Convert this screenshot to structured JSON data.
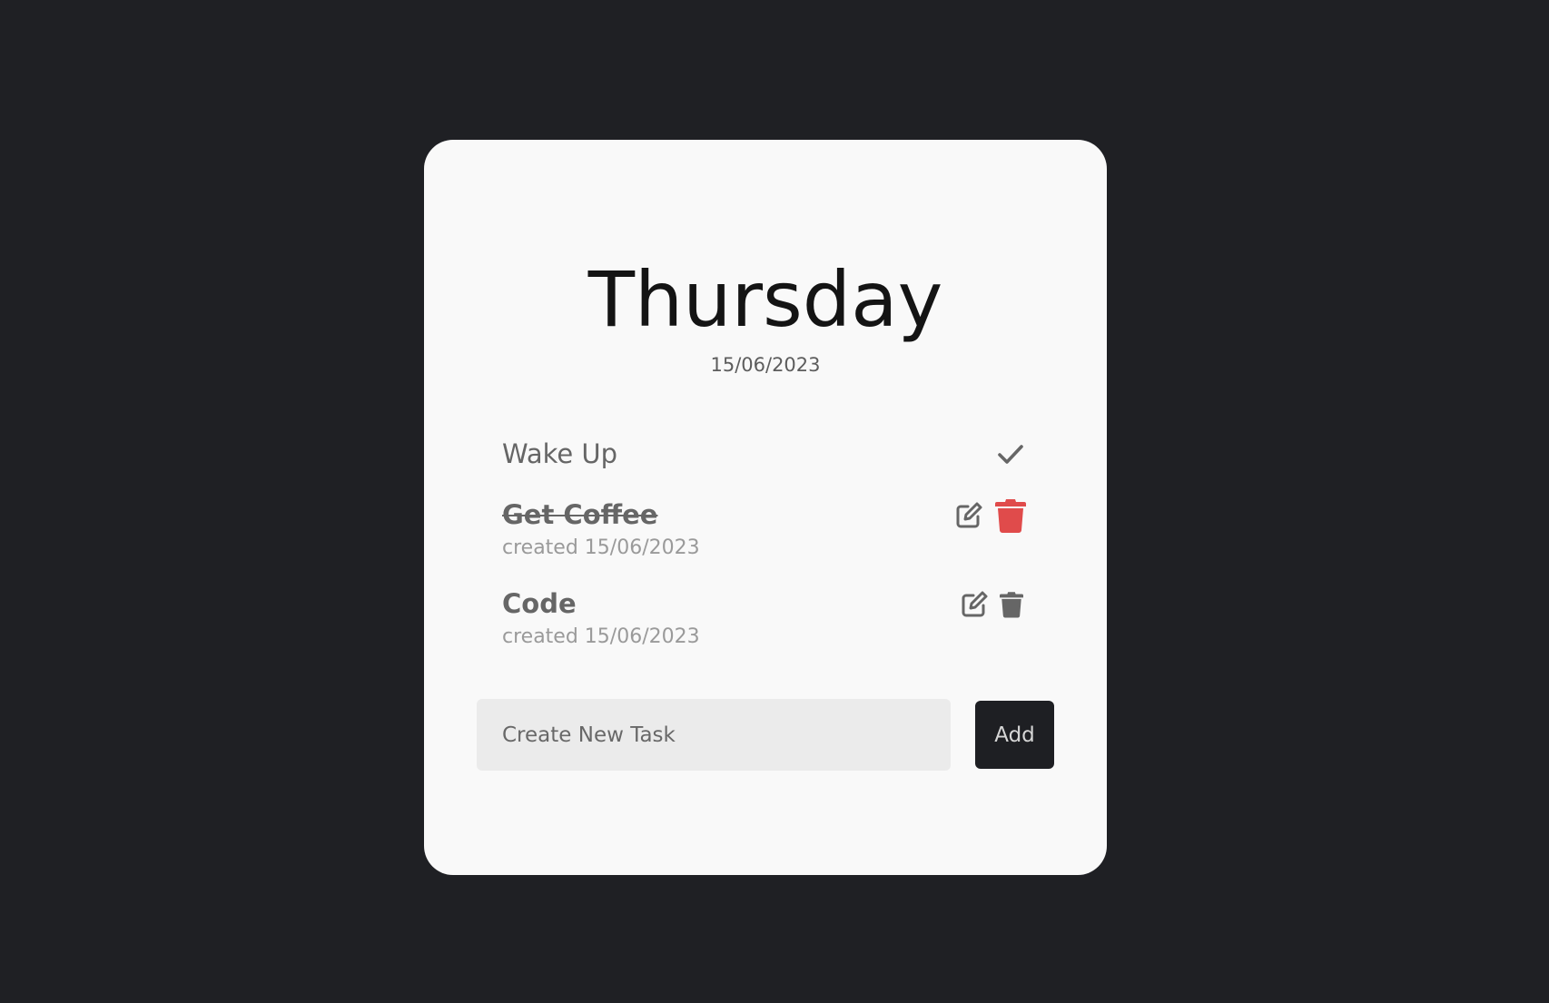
{
  "header": {
    "day": "Thursday",
    "date": "15/06/2023"
  },
  "tasks": [
    {
      "title": "Wake Up",
      "completed_icon": "check-icon"
    },
    {
      "title": "Get Coffee",
      "created": "created 15/06/2023",
      "edit_icon": "edit-icon",
      "delete_icon": "trash-icon"
    },
    {
      "title": "Code",
      "created": "created 15/06/2023",
      "edit_icon": "edit-icon",
      "delete_icon": "trash-icon"
    }
  ],
  "new_task": {
    "placeholder": "Create New Task",
    "add_label": "Add"
  },
  "colors": {
    "page_background": "#1f2024",
    "card_background": "#f9f9f9",
    "icon_gray": "#666666",
    "delete_active": "#e04b4b",
    "button_dark": "#1e1f23"
  }
}
